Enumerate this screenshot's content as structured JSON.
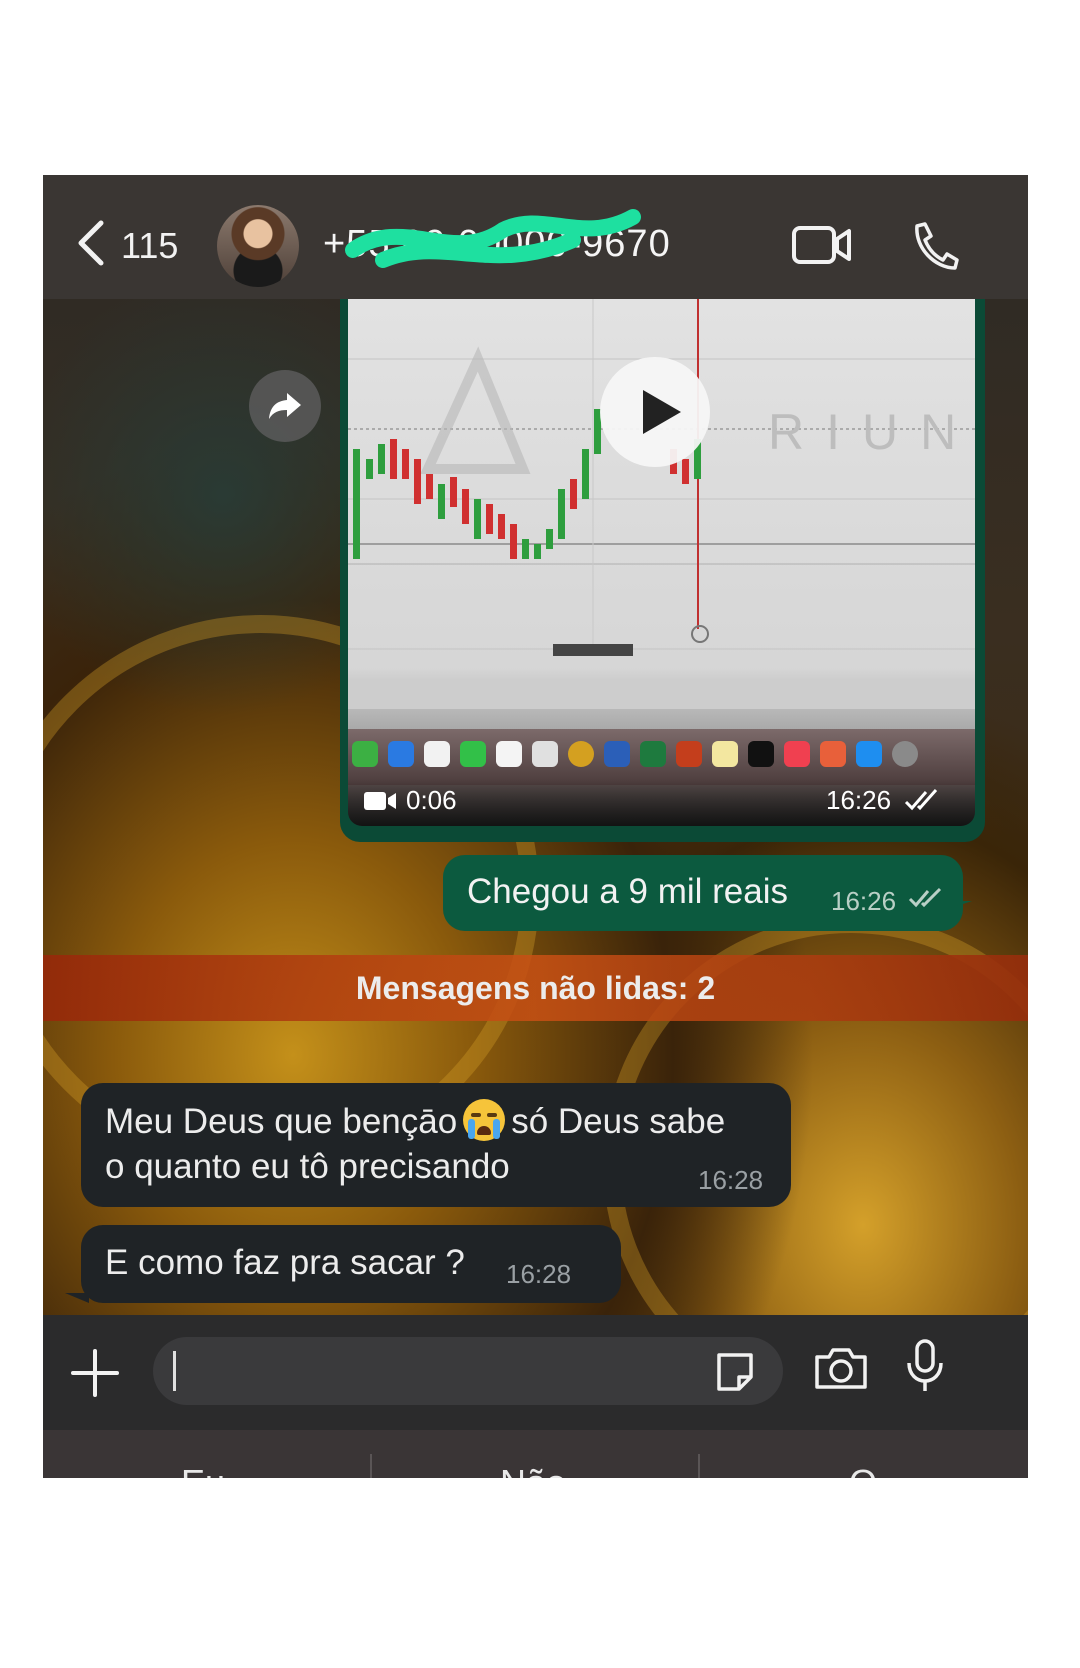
{
  "header": {
    "back_count": "115",
    "contact_number": "+55 00 00000-9670",
    "contact_visible": "+5 ‑9670"
  },
  "video_message": {
    "duration": "0:06",
    "time": "16:26",
    "watermark": "RIUN"
  },
  "messages": [
    {
      "direction": "out",
      "text": "Chegou a 9 mil reais",
      "time": "16:26"
    },
    {
      "direction": "in",
      "line1_a": "Meu Deus que bençāo",
      "line1_b": "só Deus sabe",
      "line2": "o quanto eu tô precisando",
      "time": "16:28"
    },
    {
      "direction": "in",
      "text": "E como faz pra sacar ?",
      "time": "16:28"
    }
  ],
  "unread_banner": "Mensagens não lidas: 2",
  "input": {
    "placeholder": ""
  },
  "keyboard_suggestions": [
    "Eu",
    "Não",
    "O"
  ],
  "colors": {
    "outgoing_bubble": "#0c5a3f",
    "incoming_bubble": "#1f2326",
    "header": "#3a3633",
    "unread_banner": "#c0501a",
    "scribble": "#1ee0a0"
  }
}
